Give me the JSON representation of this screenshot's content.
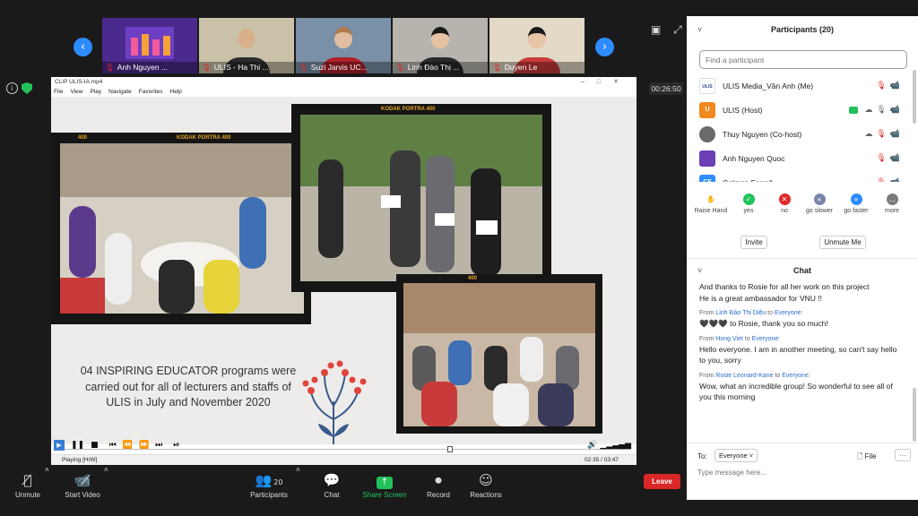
{
  "strip": {
    "tiles": [
      {
        "name": "Anh Nguyen ...",
        "bg": "#4a2a8c"
      },
      {
        "name": "ULIS - Ha Thi ...",
        "bg": "#c9c2a8"
      },
      {
        "name": "Suzi Jarvis UC...",
        "bg": "#7a8fa8"
      },
      {
        "name": "Linh Đào Thị ...",
        "bg": "#b7b4ae"
      },
      {
        "name": "Duyen Le",
        "bg": "#e2d9c6"
      }
    ]
  },
  "stage": {
    "timer": "00:26:50"
  },
  "player": {
    "title": "CLIP ULIS-IA.mp4",
    "menu": [
      "File",
      "View",
      "Play",
      "Navigate",
      "Favorites",
      "Help"
    ],
    "caption": "04 INSPIRING EDUCATOR programs were carried out for all of lecturers and staffs of ULIS in July and November 2020",
    "film_label_a": "KODAK PORTRA 400",
    "film_label_b": "KODAK PORTRA 400",
    "film_num": "400",
    "status_text": "Playing [H/W]",
    "time_text": "02:35 / 03:47",
    "progress_pct": 68
  },
  "toolbar": {
    "unmute": "Unmute",
    "start_video": "Start Video",
    "participants": "Participants",
    "participants_count": "20",
    "chat": "Chat",
    "share": "Share Screen",
    "record": "Record",
    "reactions": "Reactions",
    "leave": "Leave"
  },
  "panel": {
    "title": "Participants (20)",
    "search_placeholder": "Find a participant",
    "participants": [
      {
        "name": "ULIS Media_Vân Anh (Me)",
        "avatar": "ULIS",
        "color": "#ffffff"
      },
      {
        "name": "ULIS (Host)",
        "avatar": "U",
        "color": "#f0891e"
      },
      {
        "name": "Thuy Nguyen (Co-host)",
        "avatar": "",
        "color": "#6a6a6a"
      },
      {
        "name": "Anh Nguyen Quoc",
        "avatar": "",
        "color": "#6b3fb5"
      },
      {
        "name": "Colman Farrell",
        "avatar": "CF",
        "color": "#2d8cff"
      }
    ],
    "reactions": [
      {
        "label": "Raise Hand",
        "color": "#2d8cff",
        "glyph": "✋"
      },
      {
        "label": "yes",
        "color": "#23c15a",
        "glyph": "✓"
      },
      {
        "label": "no",
        "color": "#e02828",
        "glyph": "✕"
      },
      {
        "label": "go slower",
        "color": "#7a86a8",
        "glyph": "«"
      },
      {
        "label": "go faster",
        "color": "#2d8cff",
        "glyph": "»"
      },
      {
        "label": "more",
        "color": "#7a7a7a",
        "glyph": "…"
      }
    ],
    "invite": "Invite",
    "unmute_me": "Unmute Me",
    "chat_title": "Chat",
    "messages": [
      {
        "from": "",
        "to": "",
        "text": "And thanks to Rosie for all her work on this project"
      },
      {
        "from": "",
        "to": "",
        "text": "He is a great ambassador for VNU !!"
      },
      {
        "from": "Linh Đào Thị Diệu",
        "to": "Everyone",
        "text": "🖤🖤🖤 to Rosie, thank you so much!"
      },
      {
        "from": "Hong Viet",
        "to": "Everyone",
        "text": "Hello everyone. I am in another meeting, so can't say hello to you, sorry"
      },
      {
        "from": "Rosie Leonard-Kane",
        "to": "Everyone",
        "text": "Wow, what an incredible group! So wonderful to see all of you this morning"
      }
    ],
    "from_word": "From",
    "to_word": "to",
    "to_label": "To:",
    "to_value": "Everyone",
    "file_label": "File",
    "input_placeholder": "Type message here..."
  }
}
